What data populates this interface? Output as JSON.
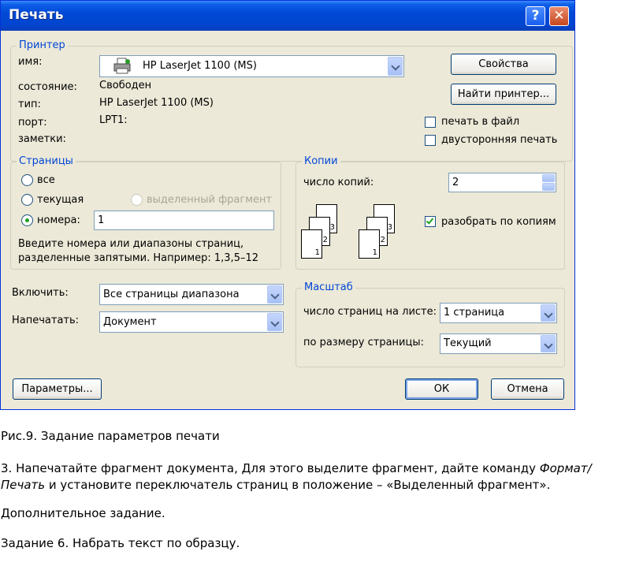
{
  "window": {
    "title": "Печать",
    "help_glyph": "?",
    "close_glyph": "✕"
  },
  "printer": {
    "legend": "Принтер",
    "name_label": "имя:",
    "name_value": "HP LaserJet 1100 (MS)",
    "status_label": "состояние:",
    "status_value": "Свободен",
    "type_label": "тип:",
    "type_value": "HP LaserJet 1100 (MS)",
    "port_label": "порт:",
    "port_value": "LPT1:",
    "notes_label": "заметки:",
    "properties_button": "Свойства",
    "find_button": "Найти принтер...",
    "print_to_file": "печать в файл",
    "duplex": "двусторонняя печать"
  },
  "pages": {
    "legend": "Страницы",
    "all": "все",
    "current": "текущая",
    "selection": "выделенный фрагмент",
    "numbers": "номера:",
    "numbers_value": "1",
    "hint_line1": "Введите номера или диапазоны страниц,",
    "hint_line2": "разделенные запятыми. Например: 1,3,5–12"
  },
  "copies": {
    "legend": "Копии",
    "count_label": "число копий:",
    "count_value": "2",
    "collate": "разобрать по копиям",
    "page_numbers": [
      "1",
      "2",
      "3"
    ]
  },
  "include": {
    "label": "Включить:",
    "value": "Все страницы диапазона"
  },
  "print_what": {
    "label": "Напечатать:",
    "value": "Документ"
  },
  "scale": {
    "legend": "Масштаб",
    "pages_per_sheet_label": "число страниц на листе:",
    "pages_per_sheet_value": "1 страница",
    "fit_label": "по размеру страницы:",
    "fit_value": "Текущий"
  },
  "footer": {
    "options_button": "Параметры...",
    "ok_button": "ОК",
    "cancel_button": "Отмена"
  },
  "text": {
    "caption": "Рис.9. Задание параметров печати",
    "p1_part1": "3. Напечатайте фрагмент документа, Для этого выделите фрагмент, дайте команду ",
    "p1_italic1": "Формат/",
    "p1_italic2": "Печать",
    "p1_part2": " и установите переключатель страниц в положение – «Выделенный фрагмент».",
    "p2": "Дополнительное задание.",
    "p3": "Задание 6. Набрать текст по образцу."
  }
}
